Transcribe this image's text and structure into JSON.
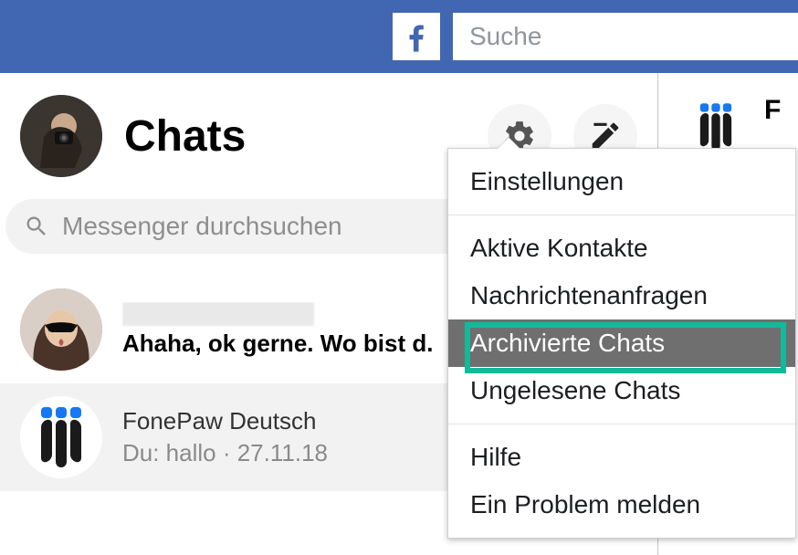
{
  "header": {
    "search_placeholder": "Suche"
  },
  "sidebar": {
    "title": "Chats",
    "search_placeholder": "Messenger durchsuchen",
    "items": [
      {
        "sender": "",
        "preview": "Ahaha, ok gerne. Wo bist d."
      },
      {
        "sender": "FonePaw Deutsch",
        "preview": "Du: hallo · 27.11.18"
      }
    ]
  },
  "right": {
    "name": "F"
  },
  "dropdown": {
    "sections": [
      [
        "Einstellungen"
      ],
      [
        "Aktive Kontakte",
        "Nachrichtenanfragen",
        "Archivierte Chats",
        "Ungelesene Chats"
      ],
      [
        "Hilfe",
        "Ein Problem melden"
      ]
    ],
    "highlighted": "Archivierte Chats"
  }
}
